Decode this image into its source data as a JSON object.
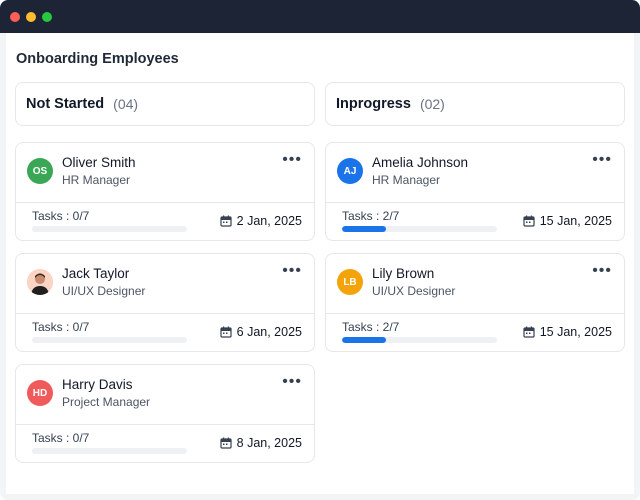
{
  "page": {
    "title": "Onboarding Employees"
  },
  "columns": [
    {
      "title": "Not Started",
      "count": "(04)",
      "cards": [
        {
          "name": "Oliver Smith",
          "role": "HR Manager",
          "initials": "OS",
          "avatar_color": "#3aa757",
          "avatar_type": "initials",
          "tasks": "Tasks : 0/7",
          "progress": 0,
          "date": "2 Jan, 2025"
        },
        {
          "name": "Jack Taylor",
          "role": "UI/UX Designer",
          "initials": "",
          "avatar_color": "#fbd4c4",
          "avatar_type": "photo",
          "tasks": "Tasks : 0/7",
          "progress": 0,
          "date": "6 Jan, 2025"
        },
        {
          "name": "Harry Davis",
          "role": "Project Manager",
          "initials": "HD",
          "avatar_color": "#f05a5a",
          "avatar_type": "initials",
          "tasks": "Tasks : 0/7",
          "progress": 0,
          "date": "8 Jan, 2025"
        }
      ]
    },
    {
      "title": "Inprogress",
      "count": "(02)",
      "cards": [
        {
          "name": "Amelia Johnson",
          "role": "HR Manager",
          "initials": "AJ",
          "avatar_color": "#1a73e8",
          "avatar_type": "initials",
          "tasks": "Tasks : 2/7",
          "progress": 0.2857,
          "date": "15 Jan, 2025"
        },
        {
          "name": "Lily Brown",
          "role": "UI/UX Designer",
          "initials": "LB",
          "avatar_color": "#f5a30a",
          "avatar_type": "initials",
          "tasks": "Tasks : 2/7",
          "progress": 0.2857,
          "date": "15 Jan, 2025"
        }
      ]
    }
  ],
  "icons": {
    "more": "more-horizontal-icon",
    "date": "calendar-icon"
  }
}
